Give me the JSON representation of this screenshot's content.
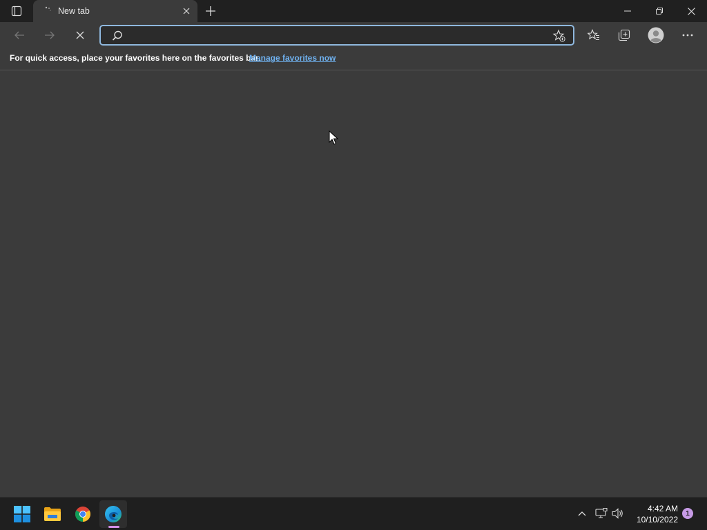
{
  "tab": {
    "title": "New tab"
  },
  "address": {
    "value": "",
    "placeholder": ""
  },
  "favorites_bar": {
    "message": "For quick access, place your favorites here on the favorites bar.",
    "link_label": "Manage favorites now"
  },
  "taskbar": {
    "apps": [
      "start-icon",
      "file-explorer-icon",
      "chrome-icon",
      "edge-icon"
    ],
    "active_app": "edge"
  },
  "clock": {
    "time": "4:42 AM",
    "date": "10/10/2022"
  },
  "notifications": {
    "count": "1"
  },
  "colors": {
    "accent": "#8fb8de",
    "link": "#6fb1ef",
    "badge": "#c79be6",
    "content_bg": "#3b3b3b",
    "titlebar_bg": "#202020"
  }
}
